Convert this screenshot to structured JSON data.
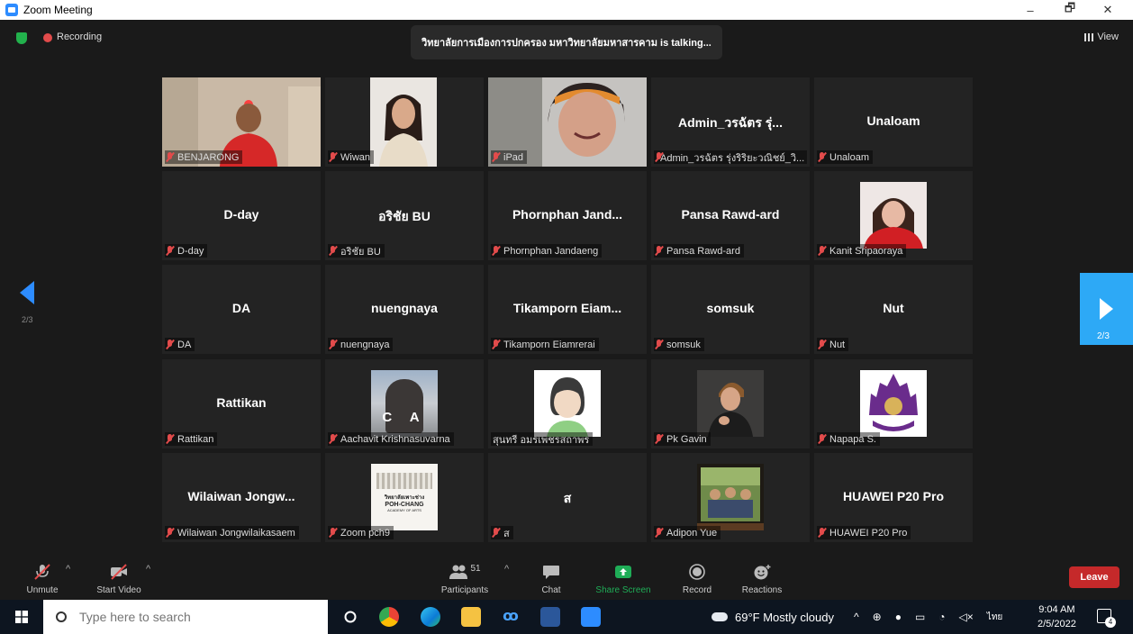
{
  "window": {
    "title": "Zoom Meeting",
    "minimize": "–",
    "restore": "🗗",
    "close": "✕"
  },
  "top": {
    "recording_label": "Recording",
    "talking_text": "วิทยาลัยการเมืองการปกครอง มหาวิทยาลัยมหาสารคาม is  talking...",
    "view_label": "View"
  },
  "pager": {
    "left_page": "2/3",
    "right_page": "2/3"
  },
  "tiles": [
    {
      "name": "BENJARONG",
      "big": ""
    },
    {
      "name": "Wiwan",
      "big": ""
    },
    {
      "name": "iPad",
      "big": ""
    },
    {
      "name": "Admin_วรฉัตร รุ่งริริยะวณิชย์_วิ...",
      "big": "Admin_วรฉัตร รุ่..."
    },
    {
      "name": "Unaloam",
      "big": "Unaloam"
    },
    {
      "name": "D-day",
      "big": "D-day"
    },
    {
      "name": "อริชัย BU",
      "big": "อริชัย BU"
    },
    {
      "name": "Phornphan Jandaeng",
      "big": "Phornphan  Jand..."
    },
    {
      "name": "Pansa Rawd-ard",
      "big": "Pansa Rawd-ard"
    },
    {
      "name": "Kanit Sripaoraya",
      "big": ""
    },
    {
      "name": "DA",
      "big": "DA"
    },
    {
      "name": "nuengnaya",
      "big": "nuengnaya"
    },
    {
      "name": "Tikamporn Eiamrerai",
      "big": "Tikamporn  Eiam..."
    },
    {
      "name": "somsuk",
      "big": "somsuk"
    },
    {
      "name": "Nut",
      "big": "Nut"
    },
    {
      "name": "Rattikan",
      "big": "Rattikan"
    },
    {
      "name": "Aachavit Krishnasuvarna",
      "big": ""
    },
    {
      "name": "สุนทรี อมรเพชรสถาพร",
      "big": ""
    },
    {
      "name": "Pk Gavin",
      "big": ""
    },
    {
      "name": "Napapa S.",
      "big": ""
    },
    {
      "name": "Wilaiwan Jongwilaikasaem",
      "big": "Wilaiwan  Jongw..."
    },
    {
      "name": "Zoom pch9",
      "big": ""
    },
    {
      "name": "ส",
      "big": "ส"
    },
    {
      "name": "Adipon Yue",
      "big": ""
    },
    {
      "name": "HUAWEI P20 Pro",
      "big": "HUAWEI P20 Pro"
    }
  ],
  "photo_text": {
    "ca_logo": "C A",
    "pohchang_line1": "วิทยาลัยเพาะช่าง",
    "pohchang_line2": "POH-CHANG",
    "pohchang_line3": "ACADEMY OF ARTS"
  },
  "toolbar": {
    "unmute": "Unmute",
    "start_video": "Start Video",
    "participants": "Participants",
    "participants_count": "51",
    "chat": "Chat",
    "share_screen": "Share Screen",
    "record": "Record",
    "reactions": "Reactions",
    "leave": "Leave"
  },
  "taskbar": {
    "search_placeholder": "Type here to search",
    "weather": "69°F  Mostly cloudy",
    "lang": "ไทย",
    "time": "9:04 AM",
    "date": "2/5/2022",
    "notifications": "4"
  },
  "colors": {
    "accent": "#2d8cff",
    "share_green": "#1fad57",
    "leave_red": "#c5292a",
    "mute_red": "#e24b4b"
  }
}
